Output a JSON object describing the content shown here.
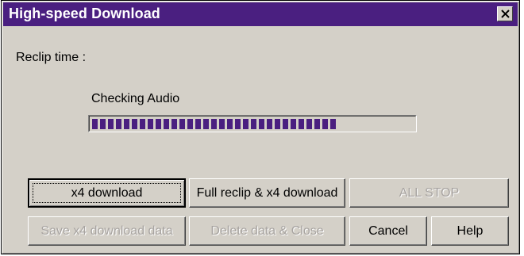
{
  "window": {
    "title": "High-speed Download",
    "accent_color": "#4a1f80",
    "face_color": "#d4d0c8"
  },
  "content": {
    "reclip_label": "Reclip time :",
    "status_label": "Checking Audio",
    "progress_fraction": 0.77
  },
  "buttons": {
    "x4_download": "x4 download",
    "full_reclip": "Full reclip & x4 download",
    "all_stop": "ALL STOP",
    "save_data": "Save x4 download data",
    "delete_close": "Delete data & Close",
    "cancel": "Cancel",
    "help": "Help"
  },
  "icons": {
    "close": "close-icon"
  }
}
